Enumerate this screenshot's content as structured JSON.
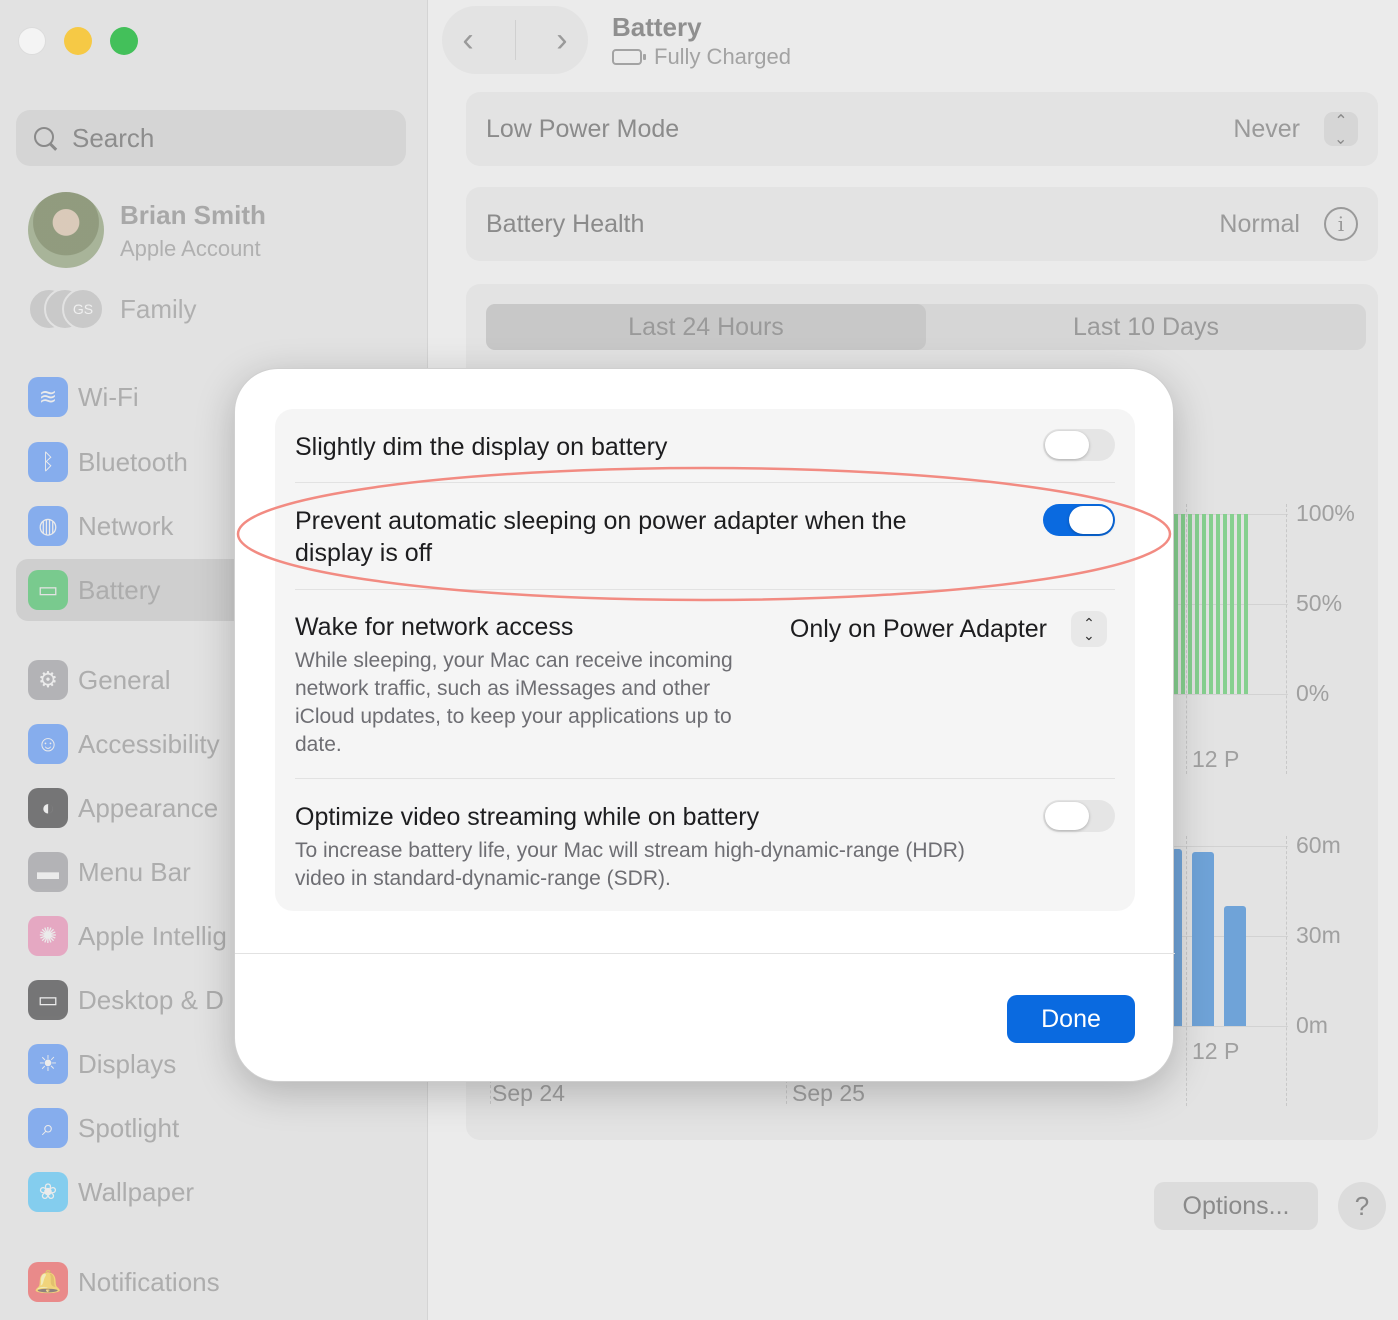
{
  "window": {
    "title": "Battery",
    "subtitle": "Fully Charged",
    "back_glyph": "‹",
    "forward_glyph": "›"
  },
  "sidebar": {
    "search_placeholder": "Search",
    "account": {
      "name": "Brian Smith",
      "subtitle": "Apple Account"
    },
    "family": {
      "label": "Family",
      "avatar_initials": "GS"
    },
    "items": [
      {
        "label": "Wi-Fi",
        "icon": "wifi-icon",
        "color": "#3b82f6",
        "glyph": "≋"
      },
      {
        "label": "Bluetooth",
        "icon": "bluetooth-icon",
        "color": "#3b82f6",
        "glyph": "ᛒ"
      },
      {
        "label": "Network",
        "icon": "globe-icon",
        "color": "#3b82f6",
        "glyph": "◍"
      },
      {
        "label": "Battery",
        "icon": "battery-icon",
        "color": "#34c759",
        "glyph": "▭",
        "selected": true
      },
      {
        "label": "General",
        "icon": "gear-icon",
        "color": "#8e8e93",
        "glyph": "⚙"
      },
      {
        "label": "Accessibility",
        "icon": "accessibility-icon",
        "color": "#3b82f6",
        "glyph": "☺"
      },
      {
        "label": "Appearance",
        "icon": "appearance-icon",
        "color": "#1d1d1f",
        "glyph": "◐"
      },
      {
        "label": "Menu Bar",
        "icon": "menu-bar-icon",
        "color": "#8e8e93",
        "glyph": "▬"
      },
      {
        "label": "Apple Intellig",
        "icon": "apple-intelligence-icon",
        "color": "#e879a9",
        "glyph": "✺"
      },
      {
        "label": "Desktop & D",
        "icon": "desktop-dock-icon",
        "color": "#1d1d1f",
        "glyph": "▭"
      },
      {
        "label": "Displays",
        "icon": "displays-icon",
        "color": "#3b82f6",
        "glyph": "☀"
      },
      {
        "label": "Spotlight",
        "icon": "spotlight-icon",
        "color": "#3b82f6",
        "glyph": "⌕"
      },
      {
        "label": "Wallpaper",
        "icon": "wallpaper-icon",
        "color": "#38bdf8",
        "glyph": "❀"
      },
      {
        "label": "Notifications",
        "icon": "notifications-icon",
        "color": "#ef4444",
        "glyph": "🔔"
      }
    ]
  },
  "main": {
    "low_power": {
      "label": "Low Power Mode",
      "value": "Never"
    },
    "health": {
      "label": "Battery Health",
      "value": "Normal"
    },
    "tabs": [
      {
        "label": "Last 24 Hours",
        "active": true
      },
      {
        "label": "Last 10 Days",
        "active": false
      }
    ],
    "level_axis": [
      "100%",
      "50%",
      "0%"
    ],
    "usage_axis": [
      "60m",
      "30m",
      "0m"
    ],
    "time_label_top": "12 P",
    "time_label_bottom": "12 P",
    "date_labels": [
      "Sep 24",
      "Sep 25"
    ],
    "options_label": "Options...",
    "help_label": "?"
  },
  "chart_data": [
    {
      "type": "bar",
      "title": "",
      "ylabel": "",
      "yticks": [
        "0%",
        "50%",
        "100%"
      ],
      "ylim": [
        0,
        100
      ],
      "visible_values": [
        100,
        100,
        100,
        100,
        100,
        100,
        100,
        100,
        100,
        100,
        100
      ],
      "color": "#86d08f",
      "xtick": "12 P"
    },
    {
      "type": "bar",
      "title": "",
      "ylabel": "",
      "yticks": [
        "0m",
        "30m",
        "60m"
      ],
      "ylim": [
        0,
        60
      ],
      "visible_values": [
        59,
        58,
        40
      ],
      "color": "#6fa3d8",
      "xtick": "12 P"
    }
  ],
  "sheet": {
    "options": [
      {
        "title": "Slightly dim the display on battery",
        "enabled": false
      },
      {
        "title": "Prevent automatic sleeping on power adapter when the display is off",
        "enabled": true,
        "highlighted": true
      },
      {
        "title": "Wake for network access",
        "description": "While sleeping, your Mac can receive incoming network traffic, such as iMessages and other iCloud updates, to keep your applications up to date.",
        "popup_value": "Only on Power Adapter"
      },
      {
        "title": "Optimize video streaming while on battery",
        "description": "To increase battery life, your Mac will stream high-dynamic-range (HDR) video in standard-dynamic-range (SDR).",
        "enabled": false
      }
    ],
    "done_label": "Done"
  },
  "colors": {
    "accent": "#0a6ae0",
    "highlight_ring": "#f28b82",
    "battery_bar": "#86d08f",
    "usage_bar": "#6fa3d8"
  }
}
